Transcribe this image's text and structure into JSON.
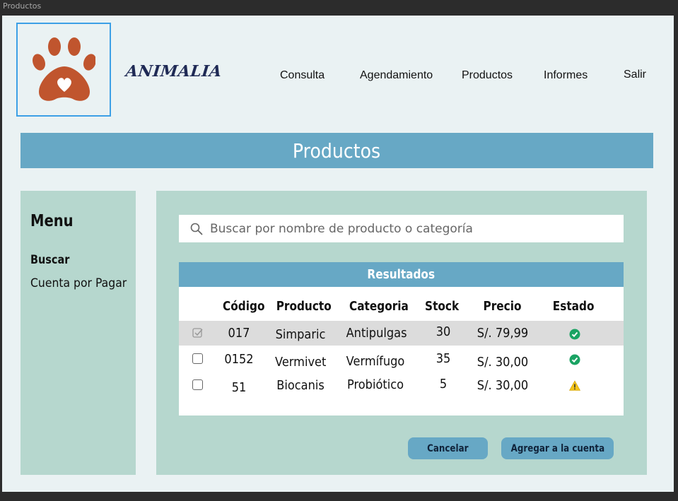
{
  "window": {
    "title": "Productos"
  },
  "brand": {
    "name": "ANIMALIA",
    "logo_icon": "paw-heart-icon",
    "logo_color": "#c0552e"
  },
  "nav": {
    "items": [
      {
        "label": "Consulta"
      },
      {
        "label": "Agendamiento"
      },
      {
        "label": "Productos"
      },
      {
        "label": "Informes"
      },
      {
        "label": "Salir"
      }
    ]
  },
  "page": {
    "title": "Productos"
  },
  "sidebar": {
    "title": "Menu",
    "items": [
      {
        "label": "Buscar",
        "active": true
      },
      {
        "label": "Cuenta por Pagar",
        "active": false
      }
    ]
  },
  "search": {
    "placeholder": "Buscar por nombre de producto o categoría",
    "value": "",
    "icon": "search-icon"
  },
  "results": {
    "title": "Resultados",
    "columns": [
      "Código",
      "Producto",
      "Categoria",
      "Stock",
      "Precio",
      "Estado"
    ],
    "rows": [
      {
        "selected": true,
        "code": "017",
        "product": "Simparic",
        "category": "Antipulgas",
        "stock": "30",
        "price": "S/. 79,99",
        "status": "ok"
      },
      {
        "selected": false,
        "code": "0152",
        "product": "Vermivet",
        "category": "Vermífugo",
        "stock": "35",
        "price": "S/. 30,00",
        "status": "ok"
      },
      {
        "selected": false,
        "code": "51",
        "product": "Biocanis",
        "category": "Probiótico",
        "stock": "5",
        "price": "S/. 30,00",
        "status": "warning"
      }
    ]
  },
  "actions": {
    "cancel_label": "Cancelar",
    "add_label": "Agregar a la cuenta"
  },
  "colors": {
    "accent": "#67a8c5",
    "panel": "#b6d7ce",
    "ok": "#1aa363",
    "warning": "#f5c518"
  }
}
